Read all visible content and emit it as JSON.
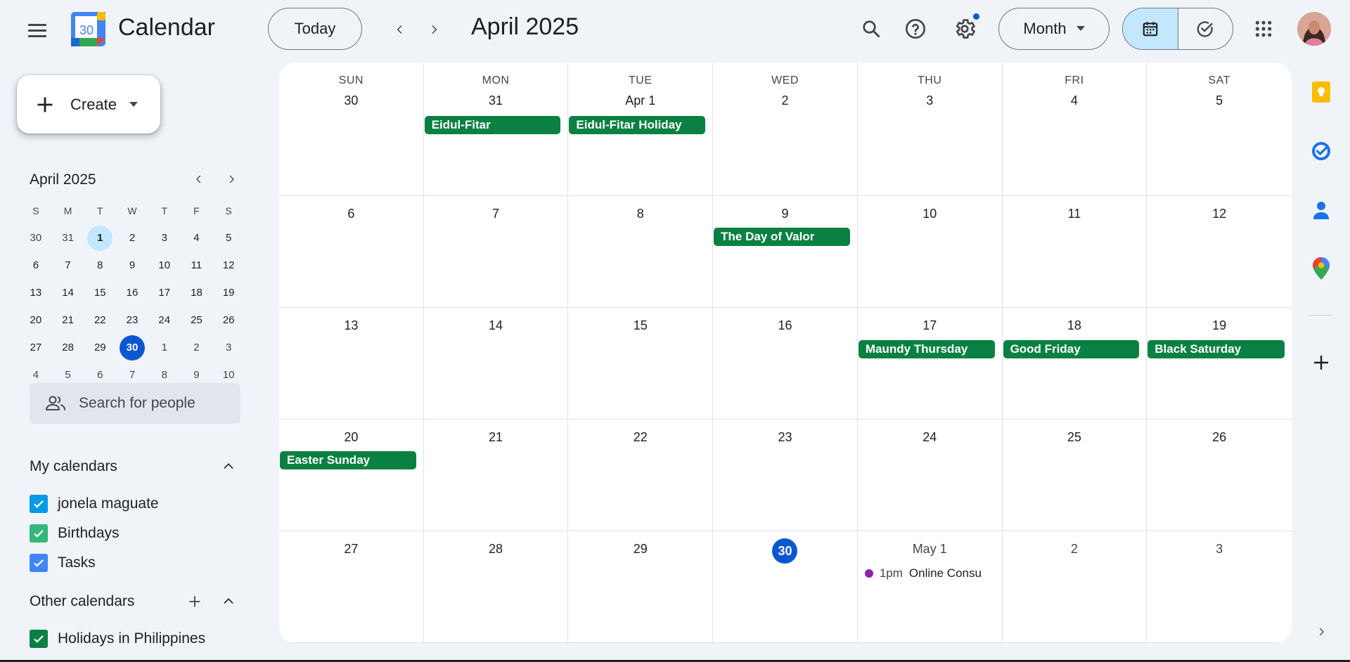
{
  "header": {
    "app_title": "Calendar",
    "logo_day": "30",
    "today_label": "Today",
    "period_title": "April 2025",
    "view_label": "Month"
  },
  "sidebar": {
    "create_label": "Create",
    "mini_calendar": {
      "title": "April 2025",
      "weekday_labels": [
        "S",
        "M",
        "T",
        "W",
        "T",
        "F",
        "S"
      ],
      "weeks": [
        [
          "30",
          "31",
          "1",
          "2",
          "3",
          "4",
          "5"
        ],
        [
          "6",
          "7",
          "8",
          "9",
          "10",
          "11",
          "12"
        ],
        [
          "13",
          "14",
          "15",
          "16",
          "17",
          "18",
          "19"
        ],
        [
          "20",
          "21",
          "22",
          "23",
          "24",
          "25",
          "26"
        ],
        [
          "27",
          "28",
          "29",
          "30",
          "1",
          "2",
          "3"
        ],
        [
          "4",
          "5",
          "6",
          "7",
          "8",
          "9",
          "10"
        ]
      ]
    },
    "search_people_placeholder": "Search for people",
    "my_calendars_title": "My calendars",
    "my_calendars": [
      {
        "name": "jonela maguate",
        "color": "#039be5"
      },
      {
        "name": "Birthdays",
        "color": "#33b679"
      },
      {
        "name": "Tasks",
        "color": "#4285f4"
      }
    ],
    "other_calendars_title": "Other calendars",
    "other_calendars": [
      {
        "name": "Holidays in Philippines",
        "color": "#0b8043"
      }
    ]
  },
  "calendar": {
    "weekdays": [
      "SUN",
      "MON",
      "TUE",
      "WED",
      "THU",
      "FRI",
      "SAT"
    ],
    "weeks": [
      [
        "30",
        "31",
        "Apr 1",
        "2",
        "3",
        "4",
        "5"
      ],
      [
        "6",
        "7",
        "8",
        "9",
        "10",
        "11",
        "12"
      ],
      [
        "13",
        "14",
        "15",
        "16",
        "17",
        "18",
        "19"
      ],
      [
        "20",
        "21",
        "22",
        "23",
        "24",
        "25",
        "26"
      ],
      [
        "27",
        "28",
        "29",
        "30",
        "May 1",
        "2",
        "3"
      ]
    ],
    "events": {
      "eidul_fitar": "Eidul-Fitar",
      "eidul_fitar_holiday": "Eidul-Fitar Holiday",
      "day_of_valor": "The Day of Valor",
      "maundy_thursday": "Maundy Thursday",
      "good_friday": "Good Friday",
      "black_saturday": "Black Saturday",
      "easter_sunday": "Easter Sunday",
      "online_consult_time": "1pm",
      "online_consult_title": "Online Consu"
    },
    "holiday_color": "#0b8043",
    "event_dot_color": "#8e24aa",
    "today_color": "#0b57d0"
  }
}
